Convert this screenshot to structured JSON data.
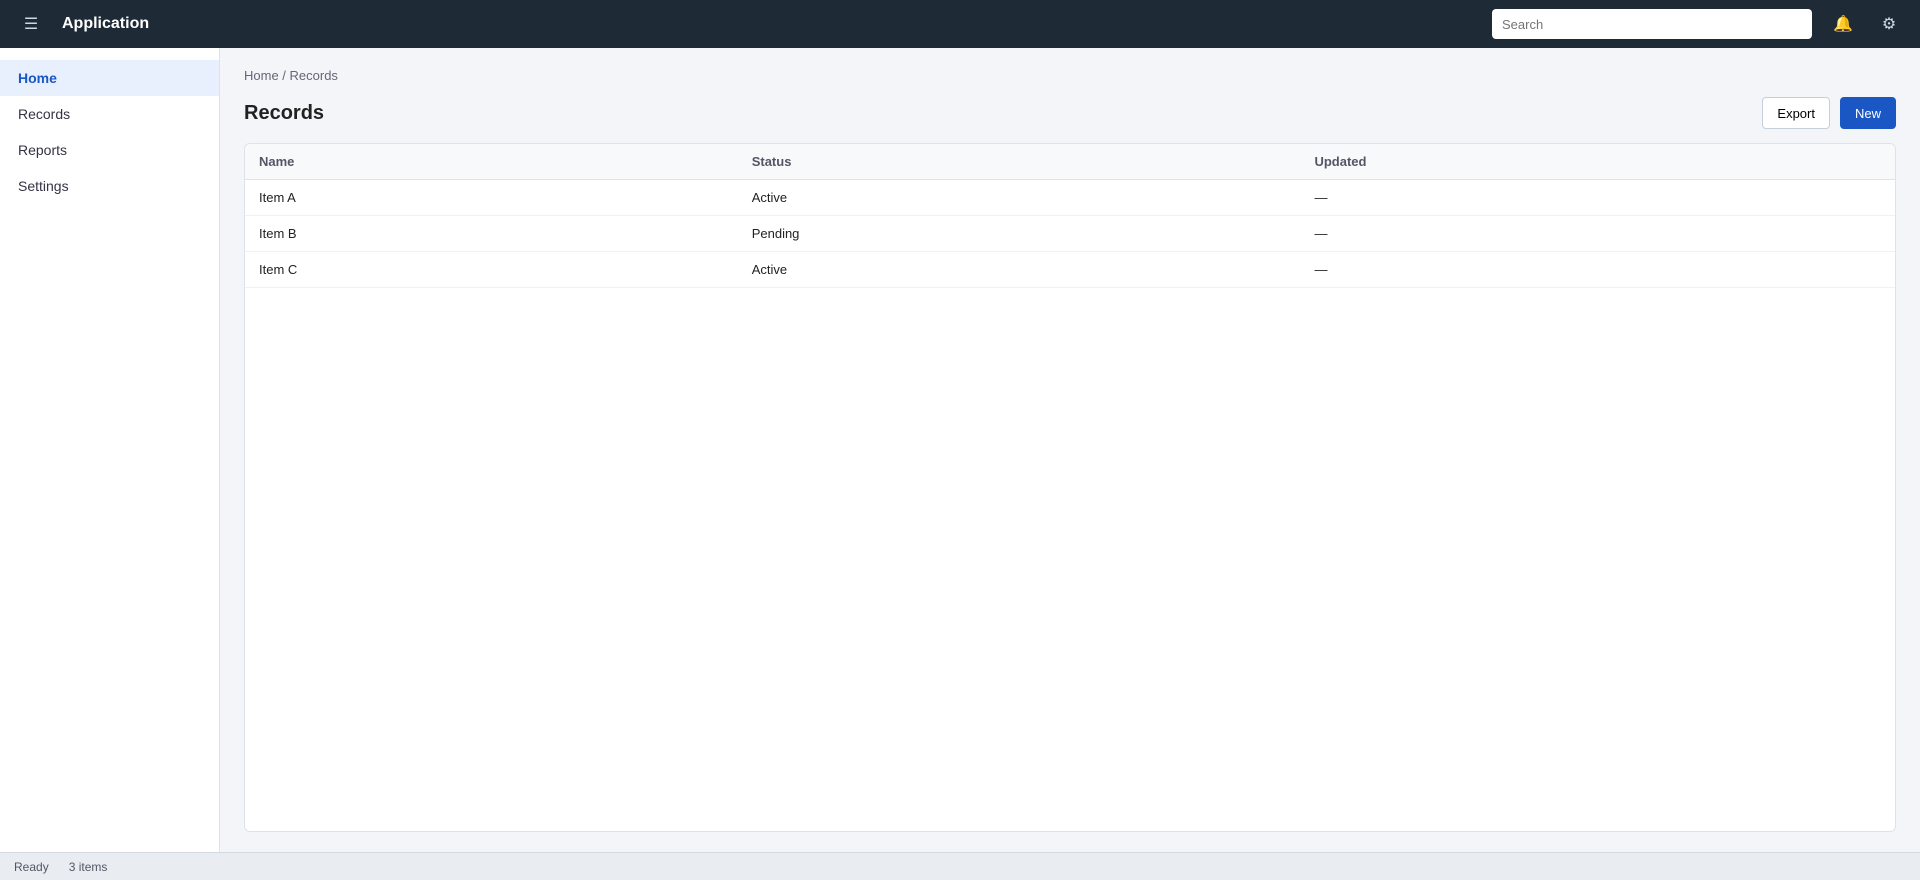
{
  "window": {
    "title": "Application"
  },
  "header": {
    "search_placeholder": "Search"
  },
  "sidebar": {
    "items": [
      {
        "label": "Home"
      },
      {
        "label": "Records"
      },
      {
        "label": "Reports"
      },
      {
        "label": "Settings"
      }
    ]
  },
  "main": {
    "breadcrumb": "Home / Records",
    "title": "Records",
    "primary_action": "New",
    "secondary_action": "Export",
    "columns": [
      "Name",
      "Status",
      "Updated"
    ],
    "rows": [
      [
        "Item A",
        "Active",
        "—"
      ],
      [
        "Item B",
        "Pending",
        "—"
      ],
      [
        "Item C",
        "Active",
        "—"
      ]
    ]
  },
  "status": {
    "left": "Ready",
    "right": "3 items"
  },
  "colors": {
    "accent": "#1a56c4",
    "topbar": "#1f2a37"
  }
}
